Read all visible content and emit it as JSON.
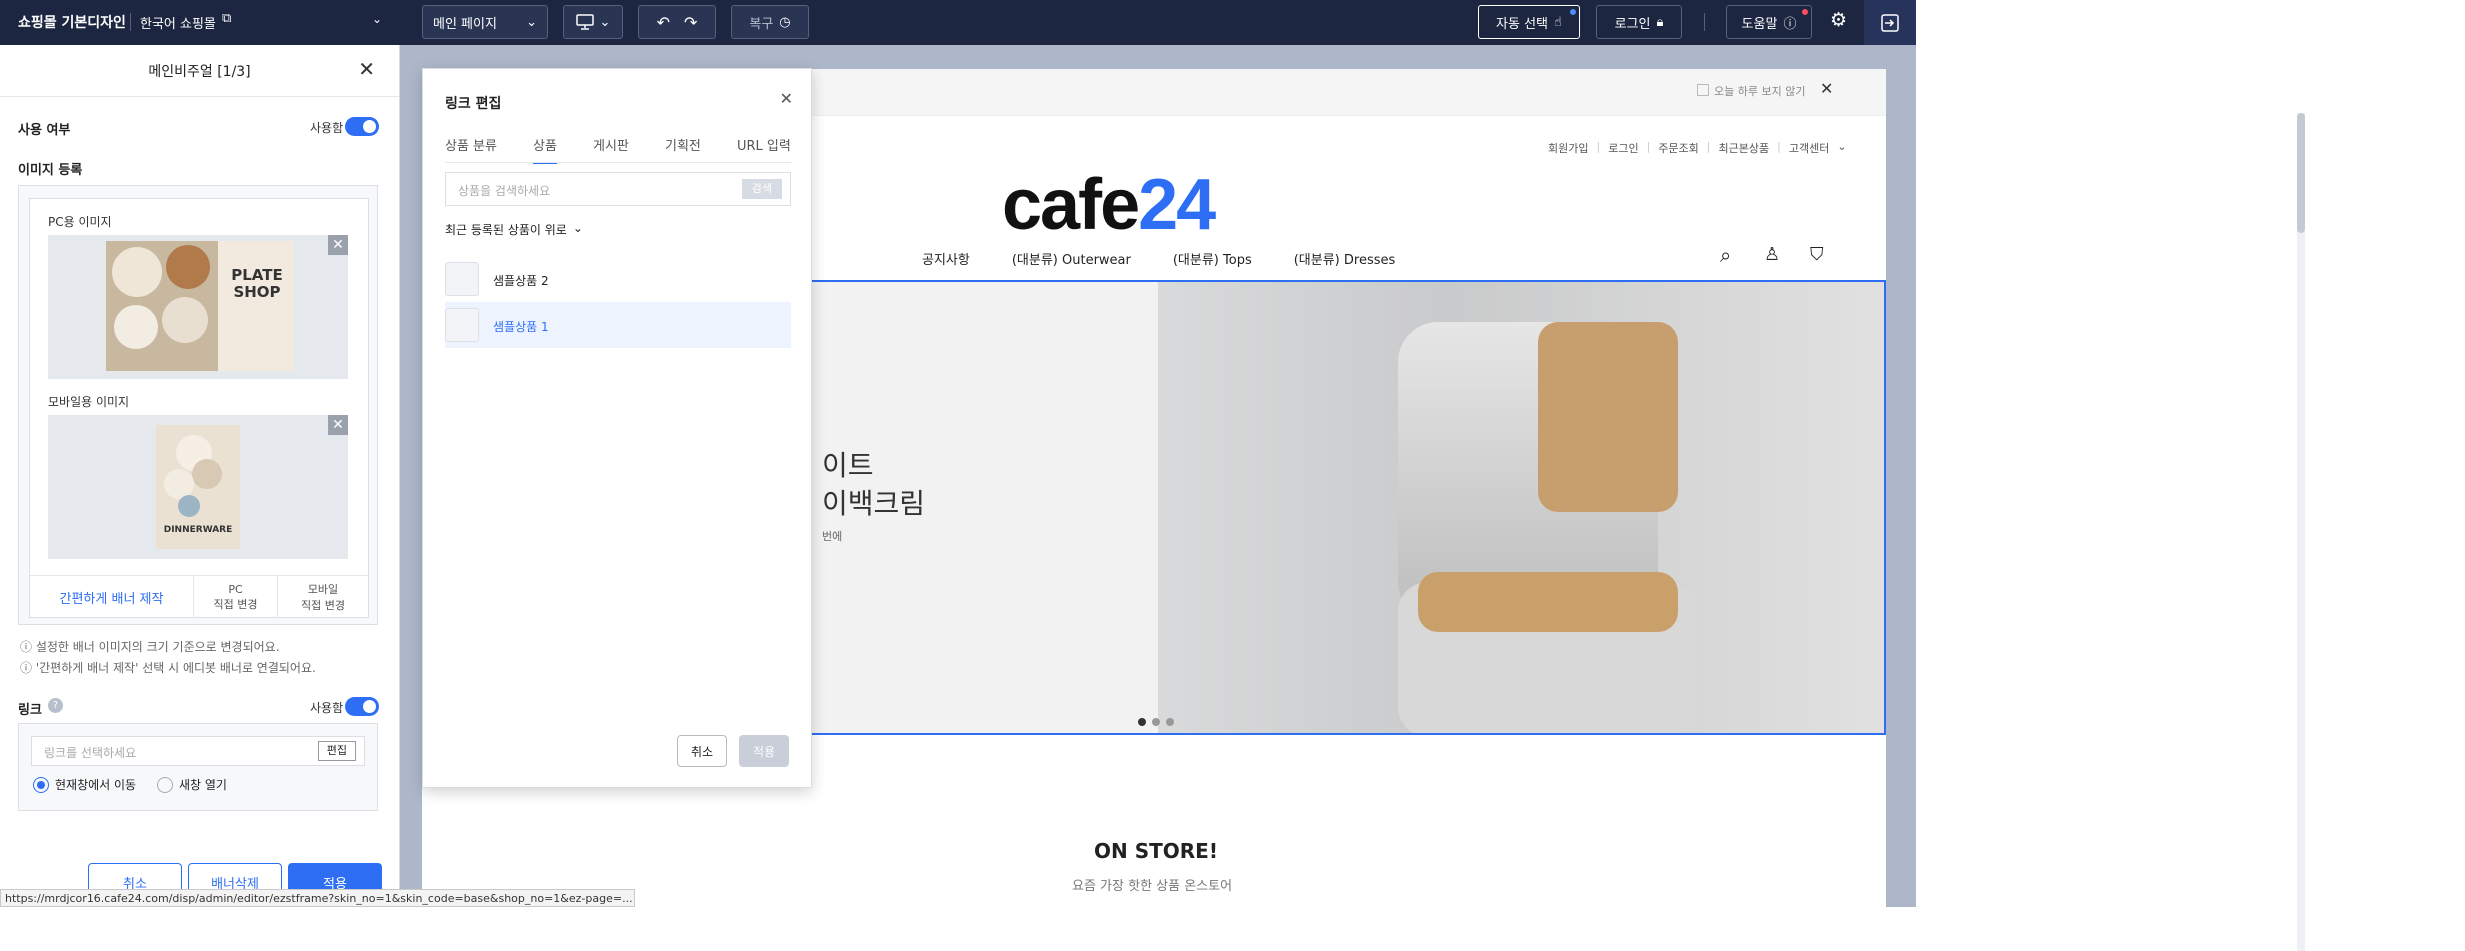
{
  "topbar": {
    "design_name": "쇼핑몰 기본디자인",
    "mall_name": "한국어 쇼핑몰",
    "page_select": "메인 페이지",
    "restore_label": "복구",
    "auto_select_label": "자동 선택",
    "login_label": "로그인",
    "help_label": "도움말"
  },
  "panel": {
    "title": "메인비주얼 [1/3]",
    "use_label": "사용 여부",
    "use_toggle": "사용함",
    "image_section": "이미지 등록",
    "pc_image_label": "PC용 이미지",
    "mobile_image_label": "모바일용 이미지",
    "pc_banner_title": "PLATE SHOP",
    "mobile_banner_title": "DINNERWARE",
    "make_banner": "간편하게 배너 제작",
    "pc_direct_1": "PC",
    "pc_direct_2": "직접 변경",
    "mobile_direct_1": "모바일",
    "mobile_direct_2": "직접 변경",
    "note1": "설정한 배너 이미지의 크기 기준으로 변경되어요.",
    "note2": "'간편하게 배너 제작' 선택 시 에디봇 배너로 연결되어요.",
    "link_label": "링크",
    "link_toggle": "사용함",
    "link_placeholder": "링크를 선택하세요",
    "link_edit": "편집",
    "radio_current": "현재창에서 이동",
    "radio_new": "새창 열기",
    "cancel": "취소",
    "delete_banner": "배너삭제",
    "apply": "적용"
  },
  "modal": {
    "title": "링크 편집",
    "tabs": [
      "상품 분류",
      "상품",
      "게시판",
      "기획전",
      "URL 입력"
    ],
    "search_placeholder": "상품을 검색하세요",
    "search_btn": "검색",
    "sort_label": "최근 등록된 상품이 위로",
    "products": [
      "샘플상품 2",
      "샘플상품 1"
    ],
    "cancel": "취소",
    "apply": "적용"
  },
  "preview": {
    "dont_show": "오늘 하루 보지 않기",
    "util_links": [
      "회원가입",
      "로그인",
      "주문조회",
      "최근본상품",
      "고객센터"
    ],
    "logo": "cafe24",
    "nav": [
      "공지사항",
      "(대분류) Outerwear",
      "(대분류) Tops",
      "(대분류) Dresses"
    ],
    "hero_line1": "이트",
    "hero_line2": "이백크림",
    "hero_small": "번에",
    "section_title": "ON STORE!",
    "section_sub": "요즘 가장 핫한 상품 온스토어"
  },
  "status_url": "https://mrdjcor16.cafe24.com/disp/admin/editor/ezstframe?skin_no=1&skin_code=base&shop_no=1&ez-page=...",
  "colors": {
    "accent": "#2d6ef5",
    "topbar": "#1c2641",
    "canvas": "#aeb7ca"
  }
}
